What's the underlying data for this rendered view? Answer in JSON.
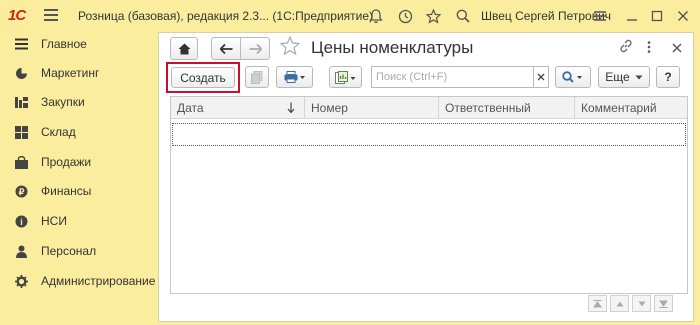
{
  "titlebar": {
    "logo": "1С",
    "app_title": "Розница (базовая), редакция 2.3... (1С:Предприятие)",
    "user_name": "Швец Сергей Петрович",
    "icons": [
      "bell-icon",
      "history-icon",
      "star-icon",
      "search-icon",
      "menu-icon",
      "minimize-icon",
      "maximize-icon",
      "close-icon"
    ]
  },
  "sidebar": {
    "items": [
      {
        "label": "Главное",
        "icon": "menu-icon"
      },
      {
        "label": "Маркетинг",
        "icon": "pie-icon"
      },
      {
        "label": "Закупки",
        "icon": "purchase-icon"
      },
      {
        "label": "Склад",
        "icon": "warehouse-icon"
      },
      {
        "label": "Продажи",
        "icon": "cart-icon"
      },
      {
        "label": "Финансы",
        "icon": "finance-icon"
      },
      {
        "label": "НСИ",
        "icon": "nsi-icon"
      },
      {
        "label": "Персонал",
        "icon": "person-icon"
      },
      {
        "label": "Администрирование",
        "icon": "gear-icon"
      }
    ]
  },
  "form": {
    "title": "Цены номенклатуры",
    "create_label": "Создать",
    "search_placeholder": "Поиск (Ctrl+F)",
    "more_label": "Еще",
    "help_label": "?",
    "columns": [
      "Дата",
      "Номер",
      "Ответственный",
      "Комментарий"
    ]
  }
}
